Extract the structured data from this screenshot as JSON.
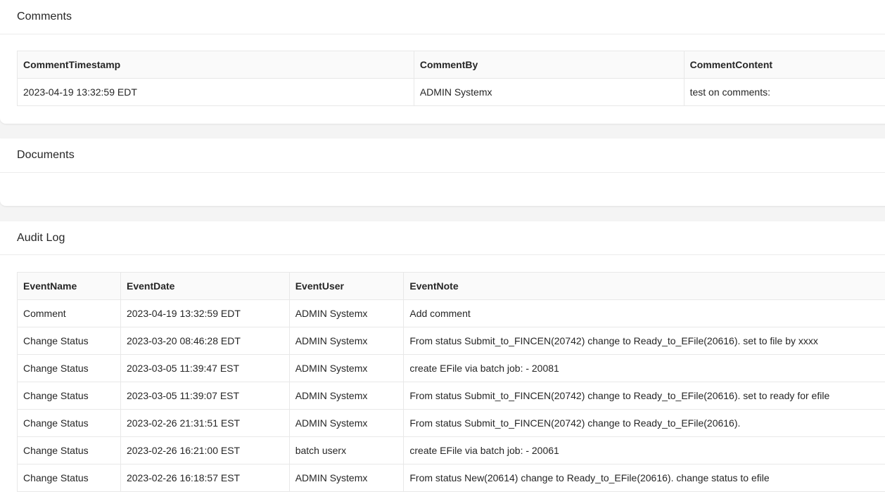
{
  "comments": {
    "title": "Comments",
    "columns": [
      "CommentTimestamp",
      "CommentBy",
      "CommentContent"
    ],
    "rows": [
      [
        "2023-04-19 13:32:59 EDT",
        "ADMIN Systemx",
        "test on comments:"
      ]
    ]
  },
  "documents": {
    "title": "Documents"
  },
  "audit_log": {
    "title": "Audit Log",
    "columns": [
      "EventName",
      "EventDate",
      "EventUser",
      "EventNote"
    ],
    "rows": [
      [
        "Comment",
        "2023-04-19 13:32:59 EDT",
        "ADMIN Systemx",
        "Add comment"
      ],
      [
        "Change Status",
        "2023-03-20 08:46:28 EDT",
        "ADMIN Systemx",
        "From status Submit_to_FINCEN(20742) change to Ready_to_EFile(20616). set to file by xxxx"
      ],
      [
        "Change Status",
        "2023-03-05 11:39:47 EST",
        "ADMIN Systemx",
        "create EFile via batch job: - 20081"
      ],
      [
        "Change Status",
        "2023-03-05 11:39:07 EST",
        "ADMIN Systemx",
        "From status Submit_to_FINCEN(20742) change to Ready_to_EFile(20616). set to ready for efile"
      ],
      [
        "Change Status",
        "2023-02-26 21:31:51 EST",
        "ADMIN Systemx",
        "From status Submit_to_FINCEN(20742) change to Ready_to_EFile(20616)."
      ],
      [
        "Change Status",
        "2023-02-26 16:21:00 EST",
        "batch userx",
        "create EFile via batch job: - 20061"
      ],
      [
        "Change Status",
        "2023-02-26 16:18:57 EST",
        "ADMIN Systemx",
        "From status New(20614) change to Ready_to_EFile(20616). change status to efile"
      ]
    ]
  }
}
